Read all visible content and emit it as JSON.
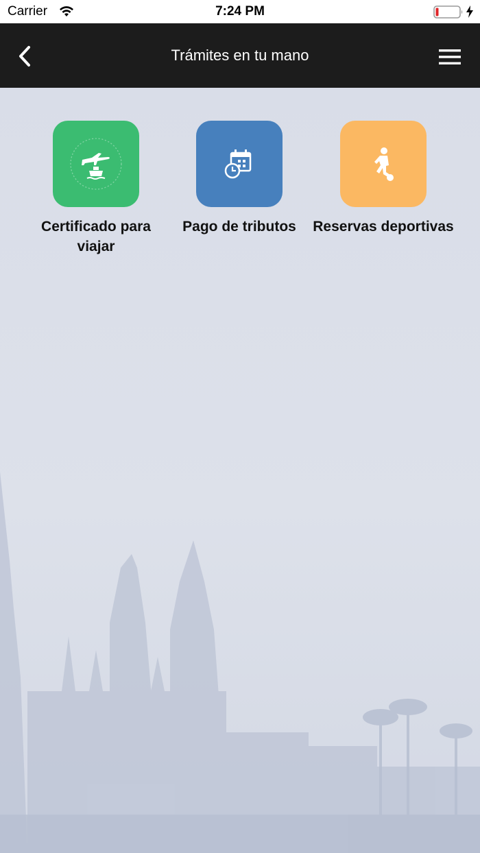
{
  "status_bar": {
    "carrier": "Carrier",
    "time": "7:24 PM"
  },
  "nav": {
    "title": "Trámites en tu mano"
  },
  "colors": {
    "nav_background": "#1c1c1c",
    "tile_green": "#3bbc71",
    "tile_blue": "#4780bd",
    "tile_orange": "#fbb862"
  },
  "tiles": [
    {
      "label": "Certificado para viajar",
      "icon": "plane-ship-icon",
      "color": "#3bbc71"
    },
    {
      "label": "Pago de tributos",
      "icon": "calendar-clock-icon",
      "color": "#4780bd"
    },
    {
      "label": "Reservas deportivas",
      "icon": "football-player-icon",
      "color": "#fbb862"
    }
  ]
}
